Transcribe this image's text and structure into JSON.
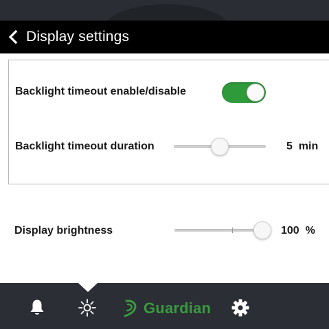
{
  "header": {
    "title": "Display settings"
  },
  "settings": {
    "backlight_enable": {
      "label": "Backlight timeout enable/disable",
      "enabled": true
    },
    "backlight_duration": {
      "label": "Backlight timeout duration",
      "value": "5",
      "unit": "min",
      "slider_fraction": 0.5
    },
    "brightness": {
      "label": "Display brightness",
      "value": "100",
      "unit": "%",
      "slider_fraction": 1.0
    }
  },
  "nav": {
    "items": [
      {
        "icon": "bell-icon",
        "active": false
      },
      {
        "icon": "brightness-icon",
        "active": true
      },
      {
        "icon": "guardian-logo",
        "active": false
      },
      {
        "icon": "gear-icon",
        "active": false
      }
    ],
    "brand_text": "Guardian"
  },
  "colors": {
    "toggle_on": "#2e9a3a",
    "brand_green": "#3a9a3f",
    "title_bar": "#000000",
    "nav_bar": "#2b2e35"
  }
}
